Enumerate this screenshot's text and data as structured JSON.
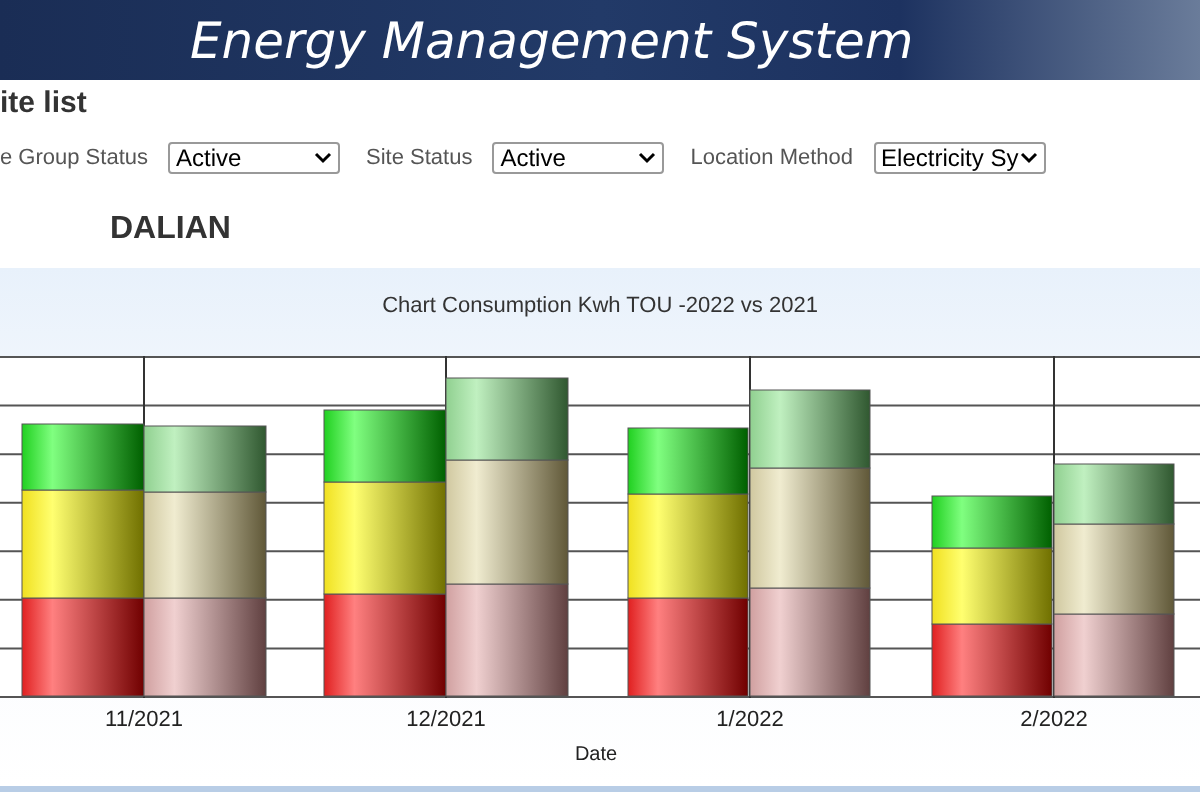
{
  "header": {
    "title": "Energy Management System"
  },
  "page": {
    "title": "ite list"
  },
  "filters": [
    {
      "label": "e Group Status",
      "value": "Active"
    },
    {
      "label": "Site Status",
      "value": "Active"
    },
    {
      "label": "Location Method",
      "value": "Electricity Sy"
    }
  ],
  "site": {
    "name": "DALIAN"
  },
  "chart": {
    "title": "Chart Consumption Kwh TOU -2022 vs 2021",
    "categories": [
      "11/2021",
      "12/2021",
      "1/2022",
      "2/2022"
    ],
    "xlabel": "Date"
  }
}
